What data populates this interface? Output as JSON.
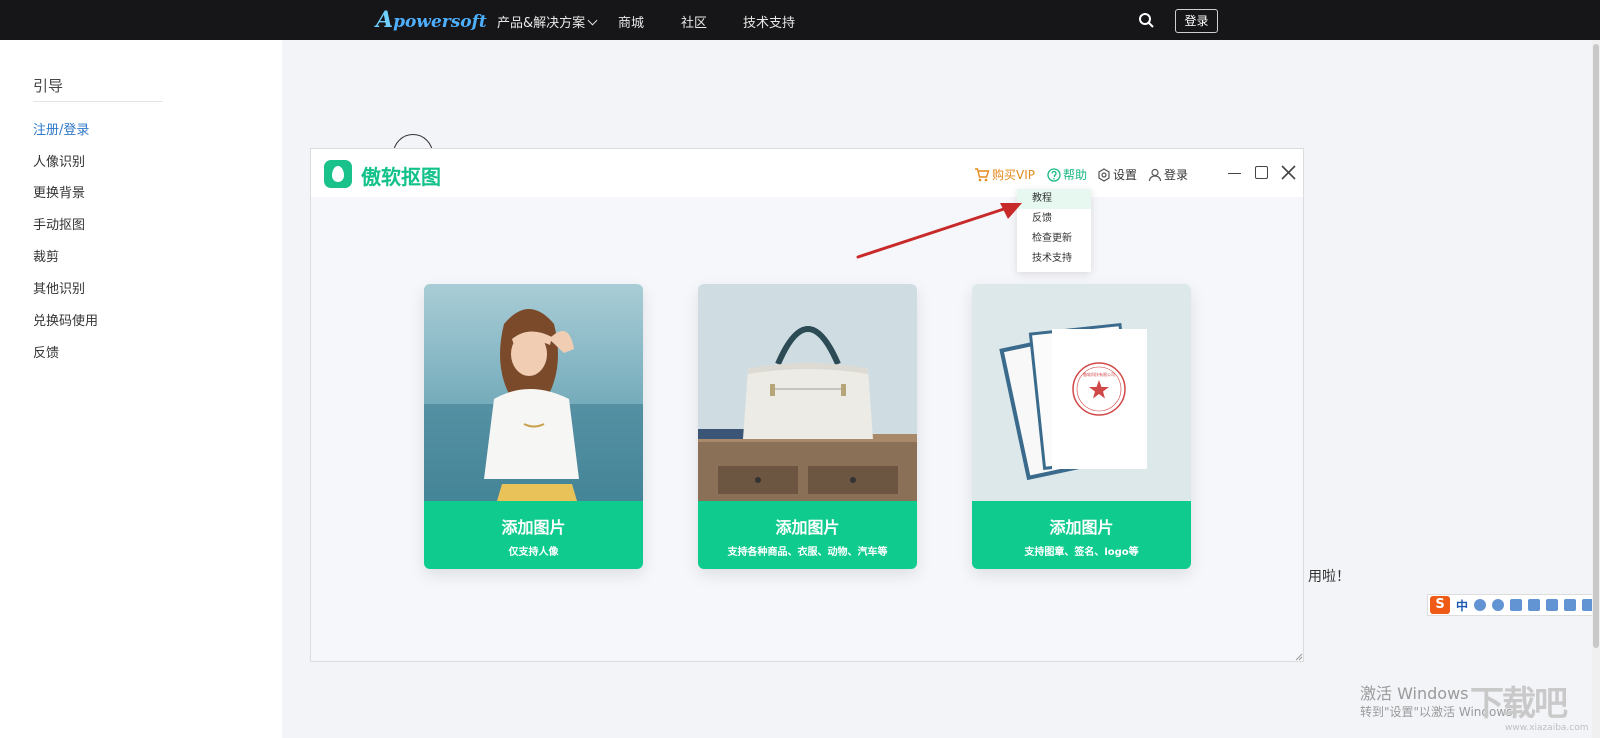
{
  "topnav": {
    "brand": "powersoft",
    "brand_initial": "A",
    "items": [
      "产品&解决方案",
      "商城",
      "社区",
      "技术支持"
    ],
    "login_label": "登录"
  },
  "guide": {
    "title": "引导",
    "items": [
      "注册/登录",
      "人像识别",
      "更换背景",
      "手动抠图",
      "裁剪",
      "其他识别",
      "兑换码使用",
      "反馈"
    ],
    "active_index": 0,
    "active_color": "#2f78c9"
  },
  "app": {
    "name": "傲软抠图",
    "brand_color": "#13c28a",
    "toolbar": {
      "buy_vip": "购买VIP",
      "help": "帮助",
      "settings": "设置",
      "login": "登录"
    },
    "help_menu": [
      "教程",
      "反馈",
      "检查更新",
      "技术支持"
    ],
    "cards": [
      {
        "title": "添加图片",
        "subtitle": "仅支持人像"
      },
      {
        "title": "添加图片",
        "subtitle": "支持各种商品、衣服、动物、汽车等"
      },
      {
        "title": "添加图片",
        "subtitle": "支持图章、签名、logo等"
      }
    ],
    "stamp_text": "傲软科技有限公司"
  },
  "background_text": "用啦！",
  "ime": {
    "logo": "S",
    "mode": "中"
  },
  "watermark": {
    "line1": "激活 Windows",
    "line2": "转到\"设置\"以激活 Windows。",
    "site_logo": "下载吧",
    "site_url": "www.xiazaiba.com"
  }
}
